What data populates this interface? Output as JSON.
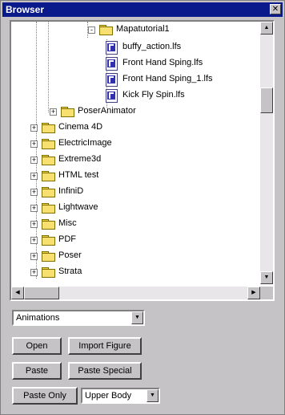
{
  "window": {
    "title": "Browser",
    "close_glyph": "✕"
  },
  "tree": {
    "items": [
      {
        "label": "Mapatutorial1",
        "kind": "folder",
        "expander": "-"
      },
      {
        "label": "buffy_action.lfs",
        "kind": "file"
      },
      {
        "label": "Front Hand Sping.lfs",
        "kind": "file"
      },
      {
        "label": "Front Hand Sping_1.lfs",
        "kind": "file"
      },
      {
        "label": "Kick Fly Spin.lfs",
        "kind": "file"
      },
      {
        "label": "PoserAnimator",
        "kind": "folder",
        "expander": "+"
      },
      {
        "label": "Cinema 4D",
        "kind": "folder",
        "expander": "+"
      },
      {
        "label": "ElectricImage",
        "kind": "folder",
        "expander": "+"
      },
      {
        "label": "Extreme3d",
        "kind": "folder",
        "expander": "+"
      },
      {
        "label": "HTML test",
        "kind": "folder",
        "expander": "+"
      },
      {
        "label": "InfiniD",
        "kind": "folder",
        "expander": "+"
      },
      {
        "label": "Lightwave",
        "kind": "folder",
        "expander": "+"
      },
      {
        "label": "Misc",
        "kind": "folder",
        "expander": "+"
      },
      {
        "label": "PDF",
        "kind": "folder",
        "expander": "+"
      },
      {
        "label": "Poser",
        "kind": "folder",
        "expander": "+"
      },
      {
        "label": "Strata",
        "kind": "folder",
        "expander": "+"
      }
    ]
  },
  "scroll": {
    "up": "▲",
    "down": "▼",
    "left": "◀",
    "right": "▶"
  },
  "category_select": {
    "value": "Animations",
    "arrow": "▼"
  },
  "buttons": {
    "open": "Open",
    "import_figure": "Import Figure",
    "paste": "Paste",
    "paste_special": "Paste Special",
    "paste_only": "Paste Only"
  },
  "body_select": {
    "value": "Upper Body",
    "arrow": "▼"
  },
  "colors": {
    "titlebar": "#0a1a8a",
    "face": "#c6c3c6",
    "folder": "#f8e070",
    "file_icon": "#3030b0"
  },
  "icons": {
    "folder": "folder-icon",
    "file": "file-icon",
    "close": "close-icon"
  }
}
